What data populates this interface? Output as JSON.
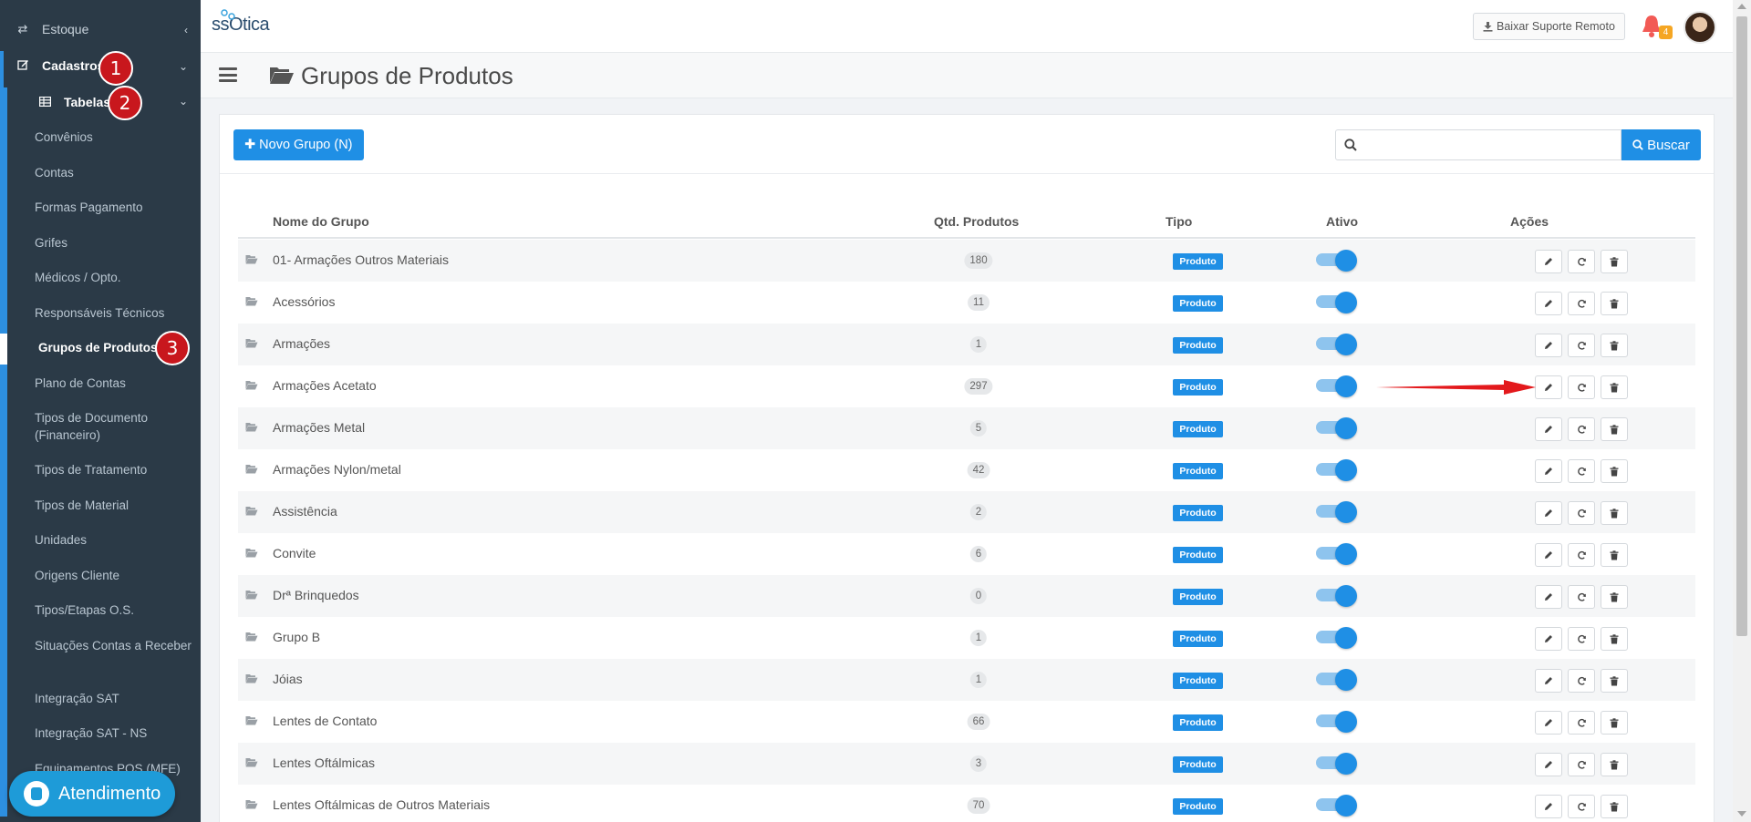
{
  "sidebar": {
    "estoque": "Estoque",
    "cadastros": "Cadastros",
    "tabelas": "Tabelas",
    "badges": [
      "1",
      "2",
      "3"
    ],
    "items": [
      "Convênios",
      "Contas",
      "Formas Pagamento",
      "Grifes",
      "Médicos / Opto.",
      "Responsáveis Técnicos",
      "Grupos de Produtos",
      "Plano de Contas",
      "Tipos de Documento (Financeiro)",
      "Tipos de Tratamento",
      "Tipos de Material",
      "Unidades",
      "Origens Cliente",
      "Tipos/Etapas O.S.",
      "Situações Contas a Receber",
      "Integração SAT",
      "Integração SAT - NS",
      "Equipamentos POS (MFE)"
    ],
    "active_item": "Grupos de Produtos",
    "atendimento": "Atendimento"
  },
  "topbar": {
    "logo": "ssOtica",
    "suporte_label": "Baixar Suporte Remoto",
    "notification_count": "4"
  },
  "page": {
    "title": "Grupos de Produtos"
  },
  "toolbar": {
    "novo_label": "Novo Grupo (N)",
    "search_value": "",
    "buscar_label": "Buscar"
  },
  "table": {
    "headers": [
      "Nome do Grupo",
      "Qtd. Produtos",
      "Tipo",
      "Ativo",
      "Ações"
    ],
    "rows": [
      {
        "name": "01- Armações Outros Materiais",
        "qtd": "180",
        "tipo": "Produto",
        "ativo": true
      },
      {
        "name": "Acessórios",
        "qtd": "11",
        "tipo": "Produto",
        "ativo": true
      },
      {
        "name": "Armações",
        "qtd": "1",
        "tipo": "Produto",
        "ativo": true
      },
      {
        "name": "Armações Acetato",
        "qtd": "297",
        "tipo": "Produto",
        "ativo": true
      },
      {
        "name": "Armações Metal",
        "qtd": "5",
        "tipo": "Produto",
        "ativo": true
      },
      {
        "name": "Armações Nylon/metal",
        "qtd": "42",
        "tipo": "Produto",
        "ativo": true
      },
      {
        "name": "Assistência",
        "qtd": "2",
        "tipo": "Produto",
        "ativo": true
      },
      {
        "name": "Convite",
        "qtd": "6",
        "tipo": "Produto",
        "ativo": true
      },
      {
        "name": "Drª Brinquedos",
        "qtd": "0",
        "tipo": "Produto",
        "ativo": true
      },
      {
        "name": "Grupo B",
        "qtd": "1",
        "tipo": "Produto",
        "ativo": true
      },
      {
        "name": "Jóias",
        "qtd": "1",
        "tipo": "Produto",
        "ativo": true
      },
      {
        "name": "Lentes de Contato",
        "qtd": "66",
        "tipo": "Produto",
        "ativo": true
      },
      {
        "name": "Lentes Oftálmicas",
        "qtd": "3",
        "tipo": "Produto",
        "ativo": true
      },
      {
        "name": "Lentes Oftálmicas de Outros Materiais",
        "qtd": "70",
        "tipo": "Produto",
        "ativo": true
      }
    ]
  },
  "colors": {
    "sidebar_bg": "#2b3a47",
    "accent": "#1f8fe5",
    "badge_red": "#c8171d",
    "arrow_red": "#e3191c"
  }
}
